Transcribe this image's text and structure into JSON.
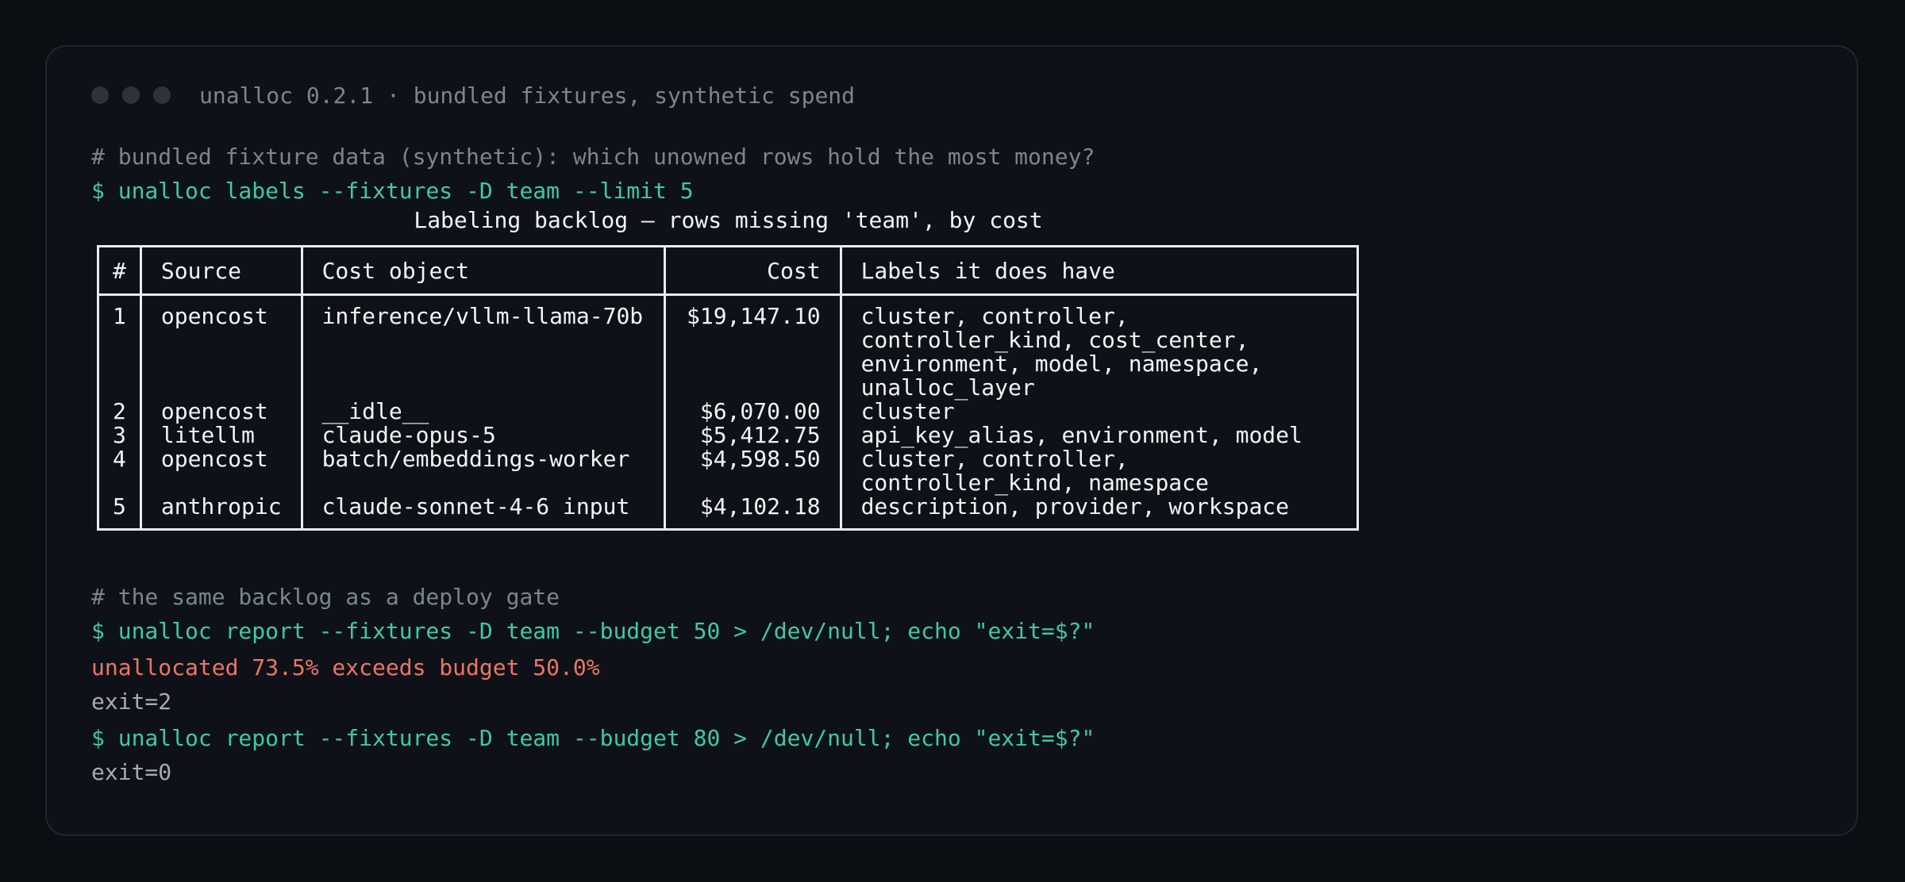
{
  "window": {
    "title": "unalloc 0.2.1 · bundled fixtures, synthetic spend"
  },
  "session": {
    "comment1": "# bundled fixture data (synthetic): which unowned rows hold the most money?",
    "cmd1": "$ unalloc labels --fixtures -D team --limit 5",
    "table_caption": "Labeling backlog — rows missing 'team', by cost",
    "table": {
      "headers": [
        "#",
        "Source",
        "Cost object",
        "Cost",
        "Labels it does have"
      ],
      "rows": [
        {
          "num": "1",
          "source": "opencost",
          "object": "inference/vllm-llama-70b",
          "cost": "$19,147.10",
          "labels": "cluster, controller,\ncontroller_kind, cost_center,\nenvironment, model, namespace,\nunalloc_layer"
        },
        {
          "num": "2",
          "source": "opencost",
          "object": "__idle__",
          "cost": "$6,070.00",
          "labels": "cluster"
        },
        {
          "num": "3",
          "source": "litellm",
          "object": "claude-opus-5",
          "cost": "$5,412.75",
          "labels": "api_key_alias, environment, model"
        },
        {
          "num": "4",
          "source": "opencost",
          "object": "batch/embeddings-worker",
          "cost": "$4,598.50",
          "labels": "cluster, controller,\ncontroller_kind, namespace"
        },
        {
          "num": "5",
          "source": "anthropic",
          "object": "claude-sonnet-4-6 input",
          "cost": "$4,102.18",
          "labels": "description, provider, workspace"
        }
      ]
    },
    "comment2": "# the same backlog as a deploy gate",
    "cmd2": "$ unalloc report --fixtures -D team --budget 50 > /dev/null; echo \"exit=$?\"",
    "error1": "unallocated 73.5% exceeds budget 50.0%",
    "out1": "exit=2",
    "cmd3": "$ unalloc report --fixtures -D team --budget 80 > /dev/null; echo \"exit=$?\"",
    "out2": "exit=0"
  },
  "colors": {
    "background": "#0b0e13",
    "panel": "#0e1218",
    "comment": "#7b8591",
    "prompt": "#3ec9a7",
    "error": "#ee7465",
    "output": "#a4acb6",
    "table_text": "#f2f4f6"
  }
}
